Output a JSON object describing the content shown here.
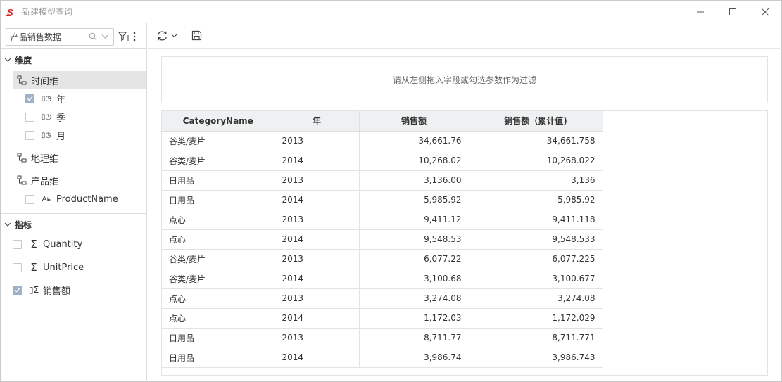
{
  "window": {
    "title": "新建模型查询"
  },
  "left_panel": {
    "search": {
      "value": "产品销售数据"
    },
    "dimensions": {
      "header": "维度",
      "groups": [
        {
          "label": "时间维",
          "fields": [
            {
              "label": "年",
              "checked": true
            },
            {
              "label": "季",
              "checked": false
            },
            {
              "label": "月",
              "checked": false
            }
          ]
        },
        {
          "label": "地理维",
          "fields": []
        },
        {
          "label": "产品维",
          "fields": [
            {
              "label": "ProductName",
              "checked": false
            }
          ]
        }
      ]
    },
    "measures": {
      "header": "指标",
      "items": [
        {
          "label": "Quantity",
          "checked": false
        },
        {
          "label": "UnitPrice",
          "checked": false
        },
        {
          "label": "销售额",
          "checked": true
        }
      ]
    }
  },
  "filter_area": {
    "placeholder": "请从左侧拖入字段或勾选参数作为过滤"
  },
  "grid": {
    "columns": [
      "CategoryName",
      "年",
      "销售额",
      "销售额（累计值)"
    ],
    "rows": [
      [
        "谷类/麦片",
        "2013",
        "34,661.76",
        "34,661.758"
      ],
      [
        "谷类/麦片",
        "2014",
        "10,268.02",
        "10,268.022"
      ],
      [
        "日用品",
        "2013",
        "3,136.00",
        "3,136"
      ],
      [
        "日用品",
        "2014",
        "5,985.92",
        "5,985.92"
      ],
      [
        "点心",
        "2013",
        "9,411.12",
        "9,411.118"
      ],
      [
        "点心",
        "2014",
        "9,548.53",
        "9,548.533"
      ],
      [
        "谷类/麦片",
        "2013",
        "6,077.22",
        "6,077.225"
      ],
      [
        "谷类/麦片",
        "2014",
        "3,100.68",
        "3,100.677"
      ],
      [
        "点心",
        "2013",
        "3,274.08",
        "3,274.08"
      ],
      [
        "点心",
        "2014",
        "1,172.03",
        "1,172.029"
      ],
      [
        "日用品",
        "2013",
        "8,711.77",
        "8,711.771"
      ],
      [
        "日用品",
        "2014",
        "3,986.74",
        "3,986.743"
      ]
    ]
  },
  "icons": {
    "logo": "app-logo-icon",
    "search": "search-icon",
    "dropdown": "chevron-down-icon",
    "filter": "filter-list-icon",
    "more": "more-vertical-icon",
    "refresh": "refresh-icon",
    "save": "save-icon",
    "minimize": "minimize-icon",
    "maximize": "maximize-icon",
    "close": "close-icon",
    "hierarchy": "hierarchy-icon",
    "date_field": "date-field-icon",
    "text_field": "text-field-icon",
    "sigma": "sigma-icon"
  },
  "colors": {
    "logo_red": "#d9262c",
    "checkbox_checked": "#9fb0c8",
    "header_bg": "#eef0f1",
    "selected_row": "#e5e5e5"
  }
}
